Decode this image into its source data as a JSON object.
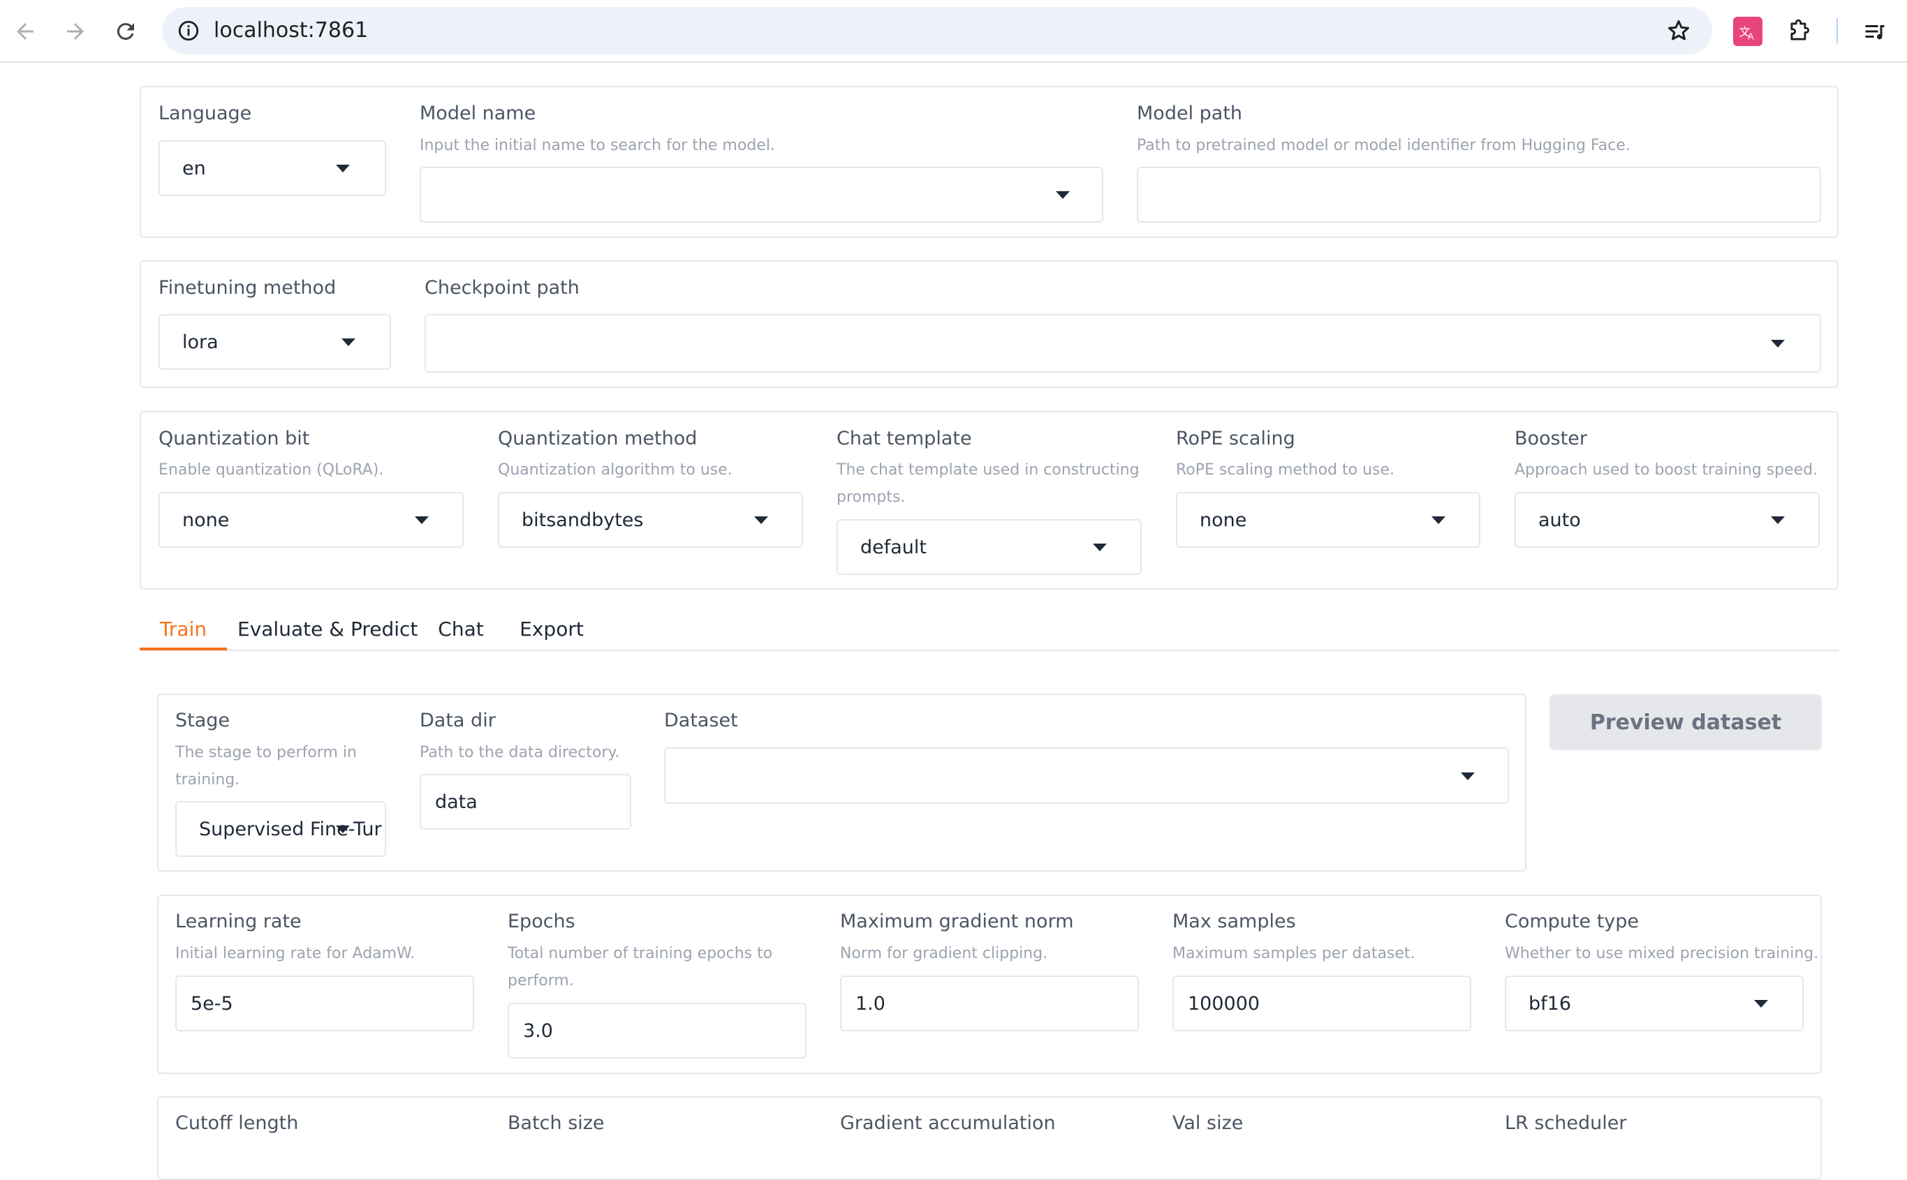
{
  "browser": {
    "url": "localhost:7861",
    "icons": {
      "back": "arrow-left-icon",
      "forward": "arrow-right-icon",
      "reload": "reload-icon",
      "site_info": "info-icon",
      "bookmark": "star-icon",
      "translate_ext": "translate-icon",
      "extensions": "puzzle-icon",
      "reading_list": "playlist-icon"
    },
    "colors": {
      "translate_ext": "#e8457a"
    }
  },
  "top": {
    "language": {
      "label": "Language",
      "value": "en"
    },
    "model_name": {
      "label": "Model name",
      "info": "Input the initial name to search for the model.",
      "value": ""
    },
    "model_path": {
      "label": "Model path",
      "info": "Path to pretrained model or model identifier from Hugging Face.",
      "value": ""
    }
  },
  "finetune": {
    "method": {
      "label": "Finetuning method",
      "value": "lora"
    },
    "checkpoint": {
      "label": "Checkpoint path",
      "value": ""
    }
  },
  "advanced": {
    "quant_bit": {
      "label": "Quantization bit",
      "info": "Enable quantization (QLoRA).",
      "value": "none"
    },
    "quant_method": {
      "label": "Quantization method",
      "info": "Quantization algorithm to use.",
      "value": "bitsandbytes"
    },
    "chat_template": {
      "label": "Chat template",
      "info_line1": "The chat template used in constructing",
      "info_line2": "prompts.",
      "value": "default"
    },
    "rope": {
      "label": "RoPE scaling",
      "info": "RoPE scaling method to use.",
      "value": "none"
    },
    "booster": {
      "label": "Booster",
      "info": "Approach used to boost training speed.",
      "value": "auto"
    }
  },
  "tabs": [
    "Train",
    "Evaluate & Predict",
    "Chat",
    "Export"
  ],
  "accent_color": "#f97316",
  "train": {
    "stage": {
      "label": "Stage",
      "info_line1": "The stage to perform in",
      "info_line2": "training.",
      "value": "Supervised Fine-Tur"
    },
    "data_dir": {
      "label": "Data dir",
      "info": "Path to the data directory.",
      "value": "data"
    },
    "dataset": {
      "label": "Dataset",
      "value": ""
    },
    "preview_button": "Preview dataset",
    "learning_rate": {
      "label": "Learning rate",
      "info": "Initial learning rate for AdamW.",
      "value": "5e-5"
    },
    "epochs": {
      "label": "Epochs",
      "info_line1": "Total number of training epochs to",
      "info_line2": "perform.",
      "value": "3.0"
    },
    "max_grad_norm": {
      "label": "Maximum gradient norm",
      "info": "Norm for gradient clipping.",
      "value": "1.0"
    },
    "max_samples": {
      "label": "Max samples",
      "info": "Maximum samples per dataset.",
      "value": "100000"
    },
    "compute_type": {
      "label": "Compute type",
      "info": "Whether to use mixed precision training.",
      "value": "bf16"
    },
    "next_row_labels": [
      "Cutoff length",
      "Batch size",
      "Gradient accumulation",
      "Val size",
      "LR scheduler"
    ]
  }
}
